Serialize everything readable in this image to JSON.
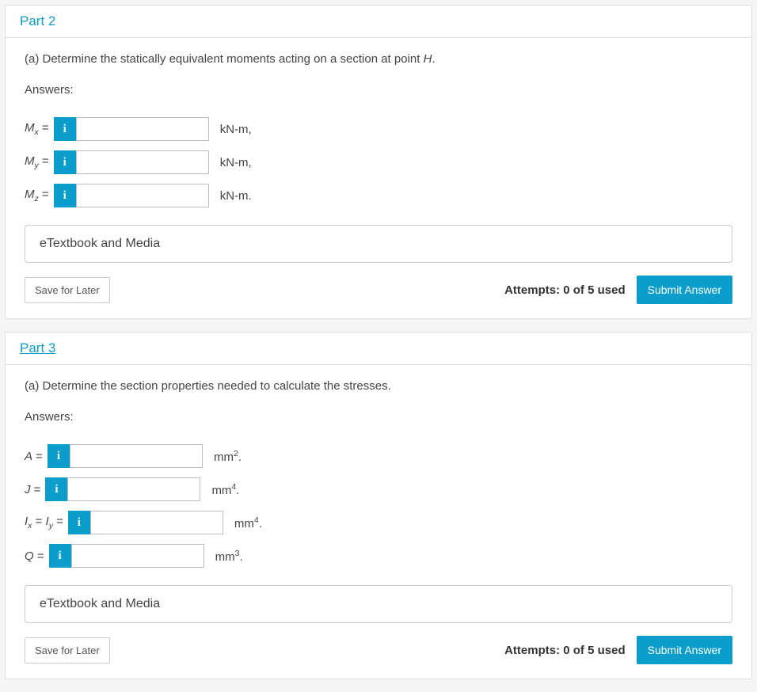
{
  "part2": {
    "title": "Part 2",
    "question_prefix": "(a) Determine the statically equivalent moments acting on a section at point ",
    "question_point": "H",
    "question_suffix": ".",
    "answers_label": "Answers:",
    "rows": [
      {
        "var_main": "M",
        "var_sub": "x",
        "eq": " = ",
        "unit_base": "kN-m,",
        "unit_sup": ""
      },
      {
        "var_main": "M",
        "var_sub": "y",
        "eq": " = ",
        "unit_base": "kN-m,",
        "unit_sup": ""
      },
      {
        "var_main": "M",
        "var_sub": "z",
        "eq": " = ",
        "unit_base": "kN-m.",
        "unit_sup": ""
      }
    ],
    "etextbook": "eTextbook and Media",
    "save": "Save for Later",
    "attempts": "Attempts: 0 of 5 used",
    "submit": "Submit Answer"
  },
  "part3": {
    "title": "Part 3",
    "question": "(a) Determine the section properties needed to calculate the stresses.",
    "answers_label": "Answers:",
    "rows": [
      {
        "label_html": "A",
        "eq": " = ",
        "unit_base": "mm",
        "unit_sup": "2",
        "unit_suffix": "."
      },
      {
        "label_html": "J",
        "eq": " = ",
        "unit_base": "mm",
        "unit_sup": "4",
        "unit_suffix": "."
      },
      {
        "label_html_ix": "I",
        "sub1": "x",
        "mid": " = ",
        "label_html_iy": "I",
        "sub2": "y",
        "eq": " = ",
        "unit_base": "mm",
        "unit_sup": "4",
        "unit_suffix": "."
      },
      {
        "label_html": "Q",
        "eq": " = ",
        "unit_base": "mm",
        "unit_sup": "3",
        "unit_suffix": "."
      }
    ],
    "etextbook": "eTextbook and Media",
    "save": "Save for Later",
    "attempts": "Attempts: 0 of 5 used",
    "submit": "Submit Answer"
  },
  "info_char": "i"
}
